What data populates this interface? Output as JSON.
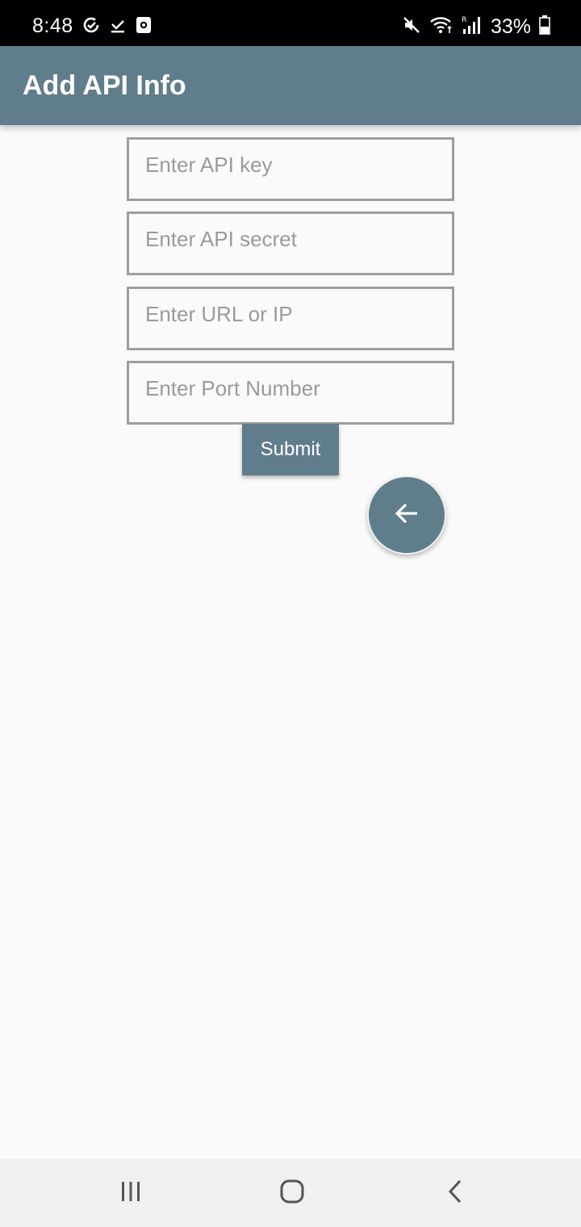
{
  "status_bar": {
    "time": "8:48",
    "battery": "33%",
    "icons_left": [
      "sync-check-icon",
      "download-done-icon",
      "screenshot-app-icon"
    ],
    "icons_right": [
      "mute-icon",
      "wifi-icon",
      "signal-icon",
      "battery-icon"
    ]
  },
  "app_bar": {
    "title": "Add API Info",
    "color": "#607d8b"
  },
  "form": {
    "api_key_placeholder": "Enter API key",
    "api_secret_placeholder": "Enter API secret",
    "url_placeholder": "Enter URL or IP",
    "port_placeholder": "Enter Port Number",
    "submit_label": "Submit"
  },
  "fab": {
    "icon": "arrow-back-icon"
  },
  "nav_bar": {
    "icons": [
      "recents-icon",
      "home-icon",
      "back-icon"
    ]
  }
}
